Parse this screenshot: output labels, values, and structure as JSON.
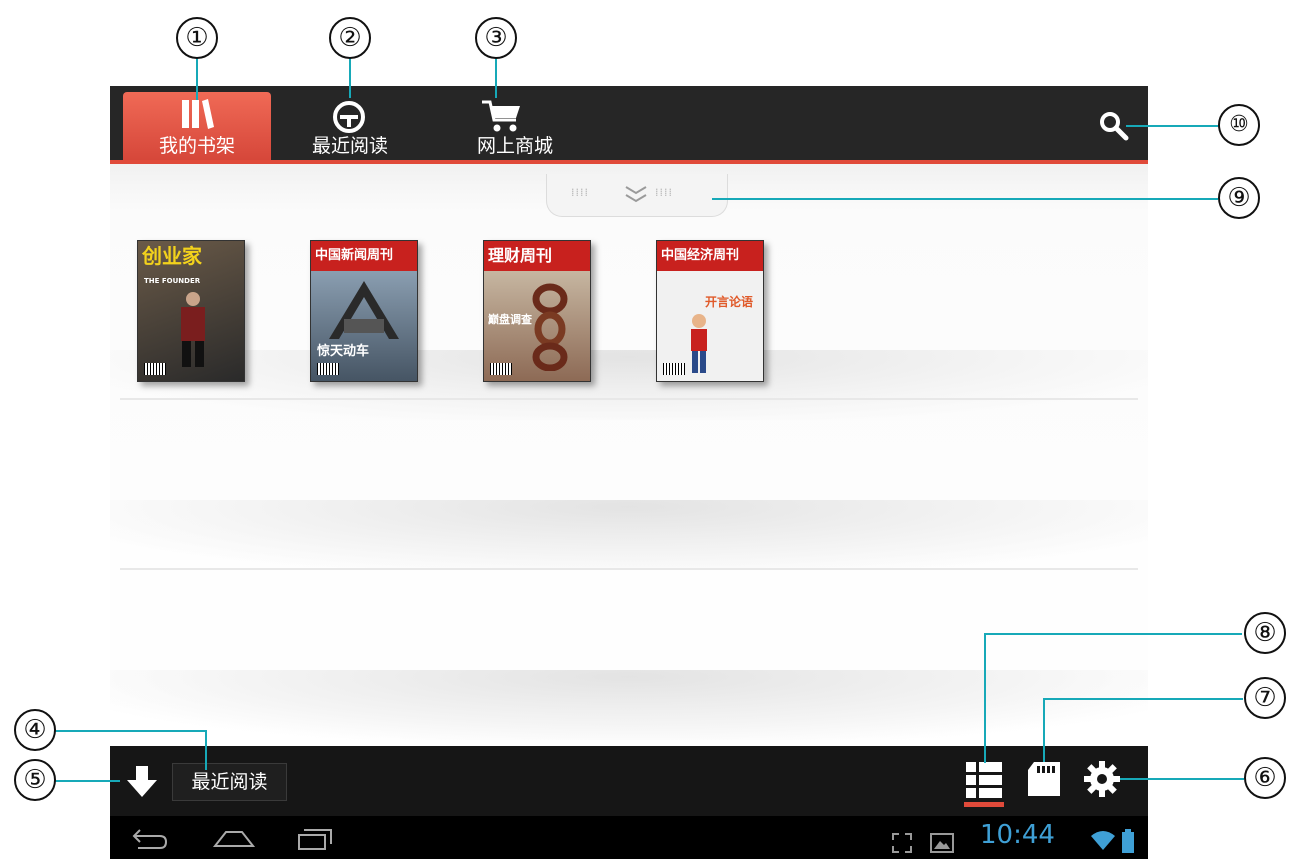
{
  "tabs": [
    {
      "label": "我的书架",
      "icon": "bookshelf-icon",
      "active": true
    },
    {
      "label": "最近阅读",
      "icon": "recent-reading-icon",
      "active": false
    },
    {
      "label": "网上商城",
      "icon": "cart-icon",
      "active": false
    }
  ],
  "search_icon": "search-icon",
  "books": [
    {
      "masthead": "创业家",
      "cover_text": "THE FOUNDER",
      "colors": [
        "#5a4a3a",
        "#2a2a2a"
      ]
    },
    {
      "masthead": "中国新闻周刊",
      "cover_text": "惊天动车",
      "colors": [
        "#6a8aa8",
        "#3a3a3a"
      ]
    },
    {
      "masthead": "理财周刊",
      "cover_text": "巅盘调查",
      "colors": [
        "#c8b8a0",
        "#6a3a2a"
      ]
    },
    {
      "masthead": "中国经济周刊",
      "cover_text": "开言论语",
      "colors": [
        "#f2f2f2",
        "#d8d8d8"
      ]
    }
  ],
  "bottom": {
    "recent_label": "最近阅读"
  },
  "status": {
    "time": "10:44"
  },
  "callouts": [
    "①",
    "②",
    "③",
    "④",
    "⑤",
    "⑥",
    "⑦",
    "⑧",
    "⑨",
    "⑩"
  ],
  "colors": {
    "accent": "#e04a3a",
    "callout_line": "#17a9b8",
    "clock": "#3fa0d6"
  }
}
